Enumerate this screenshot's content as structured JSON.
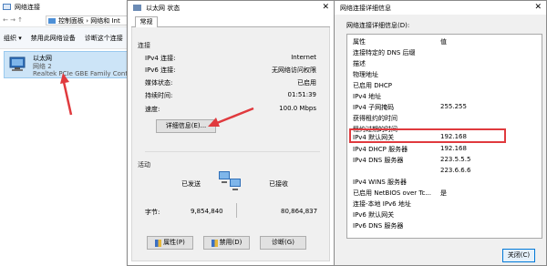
{
  "window1": {
    "title": "网络连接",
    "address": "控制面板 › 网络和 Int",
    "toolbar": [
      "组织 ▾",
      "禁用此网络设备",
      "诊断这个连接"
    ],
    "adapter": {
      "name": "以太网",
      "network": "网络 2",
      "device": "Realtek PCIe GBE Family Contr..."
    }
  },
  "window2": {
    "title": "以太网 状态",
    "close": "✕",
    "tab": "常规",
    "connection": {
      "label": "连接",
      "rows": [
        {
          "k": "IPv4 连接:",
          "v": "Internet"
        },
        {
          "k": "IPv6 连接:",
          "v": "无网络访问权限"
        },
        {
          "k": "媒体状态:",
          "v": "已启用"
        },
        {
          "k": "持续时间:",
          "v": "01:51:39"
        },
        {
          "k": "速度:",
          "v": "100.0 Mbps"
        }
      ],
      "details_button": "详细信息(E)..."
    },
    "activity": {
      "label": "活动",
      "sent_label": "已发送",
      "received_label": "已接收",
      "bytes_label": "字节:",
      "sent": "9,854,840",
      "received": "80,864,837"
    },
    "buttons": {
      "properties": "属性(P)",
      "disable": "禁用(D)",
      "diagnose": "诊断(G)"
    }
  },
  "window3": {
    "title": "网络连接详细信息",
    "close": "✕",
    "subtitle": "网络连接详细信息(D):",
    "header": {
      "k": "属性",
      "v": "值"
    },
    "rows": [
      {
        "k": "连接特定的 DNS 后缀",
        "v": ""
      },
      {
        "k": "描述",
        "v": ""
      },
      {
        "k": "物理地址",
        "v": ""
      },
      {
        "k": "已启用 DHCP",
        "v": ""
      },
      {
        "k": "IPv4 地址",
        "v": ""
      },
      {
        "k": "IPv4 子网掩码",
        "v": "255.255"
      },
      {
        "k": "获得租约的时间",
        "v": ""
      },
      {
        "k": "租约过期的时间",
        "v": ""
      },
      {
        "k": "IPv4 默认网关",
        "v": "192.168"
      },
      {
        "k": "IPv4 DHCP 服务器",
        "v": "192.168"
      },
      {
        "k": "IPv4 DNS 服务器",
        "v": "223.5.5.5"
      },
      {
        "k": "",
        "v": "223.6.6.6"
      },
      {
        "k": "IPv4 WINS 服务器",
        "v": ""
      },
      {
        "k": "已启用 NetBIOS over Tc...",
        "v": "是"
      },
      {
        "k": "连接-本地 IPv6 地址",
        "v": ""
      },
      {
        "k": "IPv6 默认网关",
        "v": ""
      },
      {
        "k": "IPv6 DNS 服务器",
        "v": ""
      }
    ],
    "close_button": "关闭(C)"
  },
  "colors": {
    "highlight": "#e03a3e",
    "selection": "#cce4f7",
    "accent": "#0078d7"
  }
}
